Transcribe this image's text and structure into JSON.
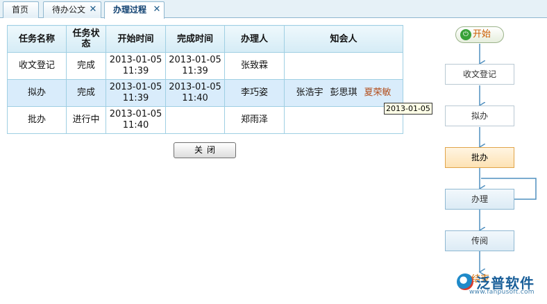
{
  "tabs": [
    {
      "label": "首页",
      "closable": false,
      "active": false
    },
    {
      "label": "待办公文",
      "closable": true,
      "active": false
    },
    {
      "label": "办理过程",
      "closable": true,
      "active": true
    }
  ],
  "table": {
    "headers": [
      "任务名称",
      "任务状态",
      "开始时间",
      "完成时间",
      "办理人",
      "知会人"
    ],
    "rows": [
      {
        "task": "收文登记",
        "status": "完成",
        "start_date": "2013-01-05",
        "start_time": "11:39",
        "end_date": "2013-01-05",
        "end_time": "11:39",
        "handler": "张致霖",
        "cc": []
      },
      {
        "task": "拟办",
        "status": "完成",
        "start_date": "2013-01-05",
        "start_time": "11:39",
        "end_date": "2013-01-05",
        "end_time": "11:40",
        "handler": "李巧姿",
        "cc": [
          "张浩宇",
          "彭思琪",
          "夏荣敏"
        ]
      },
      {
        "task": "批办",
        "status": "进行中",
        "start_date": "2013-01-05",
        "start_time": "11:40",
        "end_date": "",
        "end_time": "",
        "handler": "郑雨泽",
        "cc": []
      }
    ]
  },
  "tooltip": "2013-01-05",
  "close_button": "关闭",
  "flow": {
    "start_label": "开始",
    "start_icon": "power-icon",
    "nodes": [
      "收文登记",
      "拟办",
      "批办",
      "办理",
      "传阅"
    ],
    "current": "批办",
    "end_label": "结束"
  },
  "watermark": {
    "title": "泛普软件",
    "url": "www.fanpusoft.com"
  },
  "colors": {
    "header_bg": "#d5ecf6",
    "grid_border": "#9fcfe3",
    "selected_row": "#d9ecfb",
    "current_node": "#fde2b4",
    "highlight_name": "#b3501f"
  }
}
